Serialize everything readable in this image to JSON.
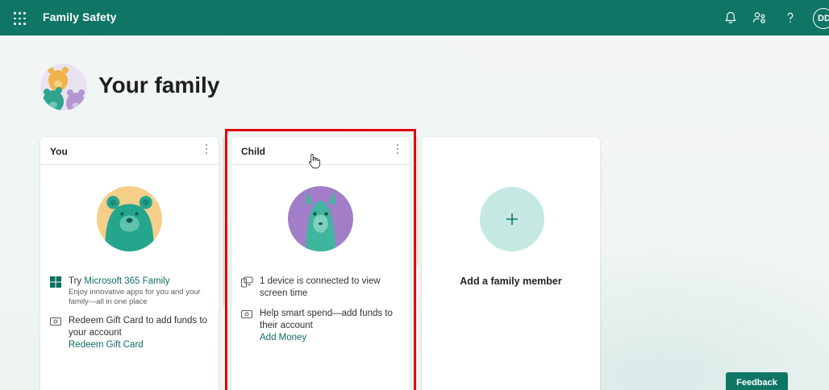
{
  "topbar": {
    "app_title": "Family Safety",
    "icons": [
      "waffle-icon",
      "bell-icon",
      "people-settings-icon",
      "help-icon"
    ],
    "user_initials": "DD"
  },
  "header": {
    "title": "Your family"
  },
  "cards": {
    "you": {
      "name": "You",
      "promo_prefix": "Try ",
      "promo_link": "Microsoft 365 Family",
      "promo_sub": "Enjoy innovative apps for you and your family—all in one place",
      "gift_text": "Redeem Gift Card to add funds to your account",
      "gift_link": "Redeem Gift Card"
    },
    "child": {
      "name": "Child",
      "device_text": "1 device is connected to view screen time",
      "spend_text": "Help smart spend—add funds to their account",
      "spend_link": "Add Money"
    },
    "add": {
      "label": "Add a family member"
    }
  },
  "feedback_label": "Feedback",
  "colors": {
    "brand": "#0f7565",
    "highlight": "#e00000",
    "add_circle": "#c6e8e2"
  }
}
